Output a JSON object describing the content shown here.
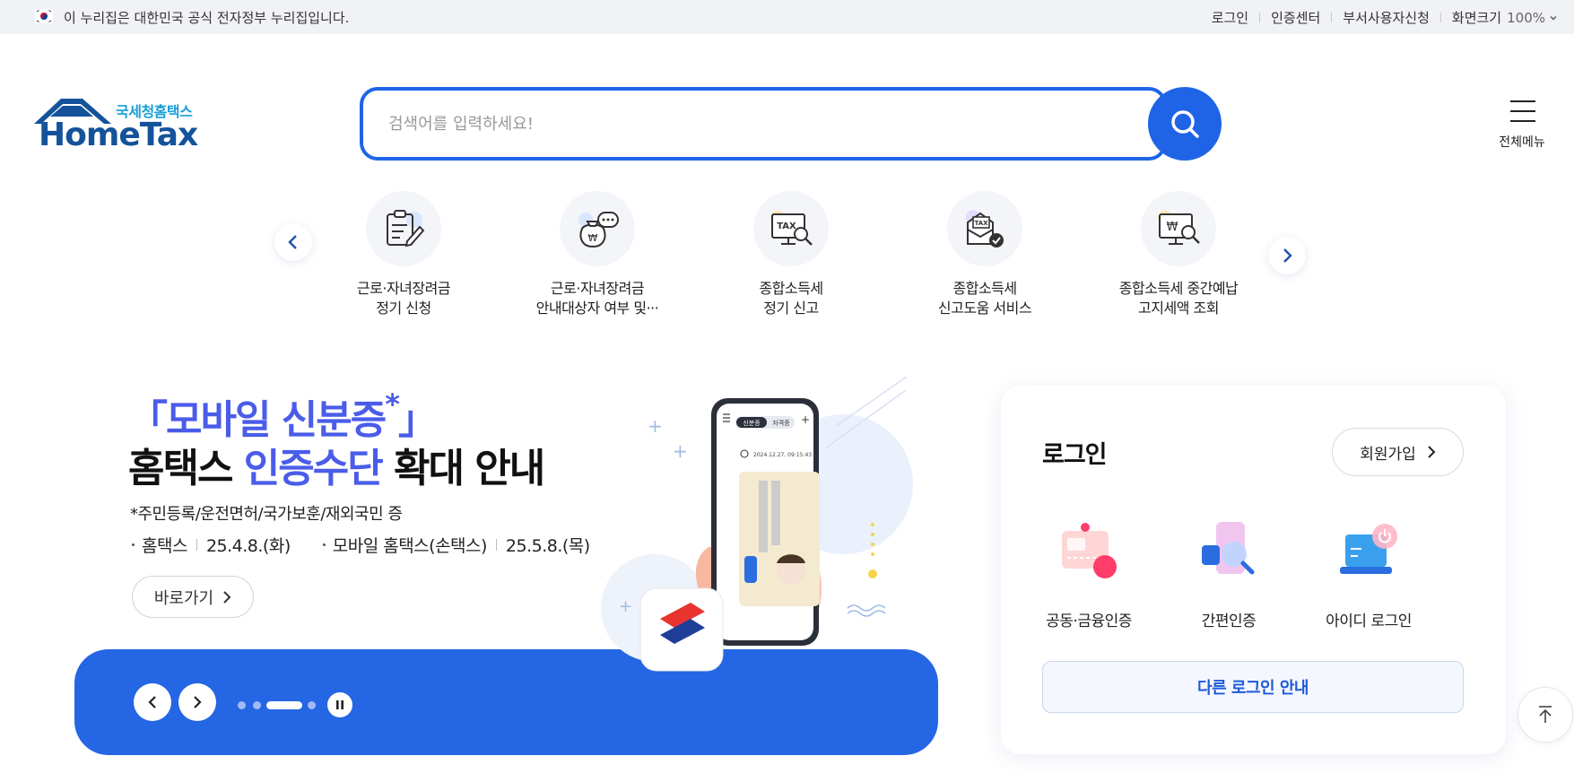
{
  "gov_bar": {
    "notice": "이 누리집은 대한민국 공식 전자정부 누리집입니다.",
    "links": [
      "로그인",
      "인증센터",
      "부서사용자신청"
    ],
    "zoom_label": "화면크기",
    "zoom_value": "100%"
  },
  "header": {
    "logo_sub": "국세청홈택스",
    "logo_main": "HomeTax",
    "search_placeholder": "검색어를 입력하세요!",
    "all_menu_label": "전체메뉴"
  },
  "quick_services": [
    {
      "line1": "근로·자녀장려금",
      "line2": "정기 신청",
      "icon": "document-edit-icon"
    },
    {
      "line1": "근로·자녀장려금",
      "line2": "안내대상자 여부 및···",
      "icon": "money-bag-chat-icon"
    },
    {
      "line1": "종합소득세",
      "line2": "정기 신고",
      "icon": "tax-monitor-search-icon"
    },
    {
      "line1": "종합소득세",
      "line2": "신고도움 서비스",
      "icon": "tax-document-check-icon"
    },
    {
      "line1": "종합소득세 중간예납",
      "line2": "고지세액 조회",
      "icon": "won-monitor-search-icon"
    }
  ],
  "banner": {
    "title_line1": "「모바일 신분증",
    "title_star": "*",
    "title_close": "」",
    "title_line2_a": "홈택스 ",
    "title_line2_hl": "인증수단",
    "title_line2_b": " 확대 안내",
    "note": "*주민등록/운전면허/국가보훈/재외국민 증",
    "item1_label": "홈택스",
    "item1_date": "25.4.8.(화)",
    "item2_label": "모바일 홈택스(손택스)",
    "item2_date": "25.5.8.(목)",
    "go_label": "바로가기",
    "phone_tab1": "신분증",
    "phone_tab2": "자격증",
    "phone_time": "2024.12.27. 09:15:43",
    "slide_total": 4,
    "slide_current": 3
  },
  "login": {
    "title": "로그인",
    "join_label": "회원가입",
    "options": [
      "공동·금융인증",
      "간편인증",
      "아이디 로그인"
    ],
    "other_label": "다른 로그인 안내"
  },
  "colors": {
    "primary": "#1f64e6",
    "banner_panel": "#2466e4",
    "title_highlight": "#4a5ce8",
    "logo_navy": "#14539a",
    "logo_sky": "#1a9fd8"
  }
}
